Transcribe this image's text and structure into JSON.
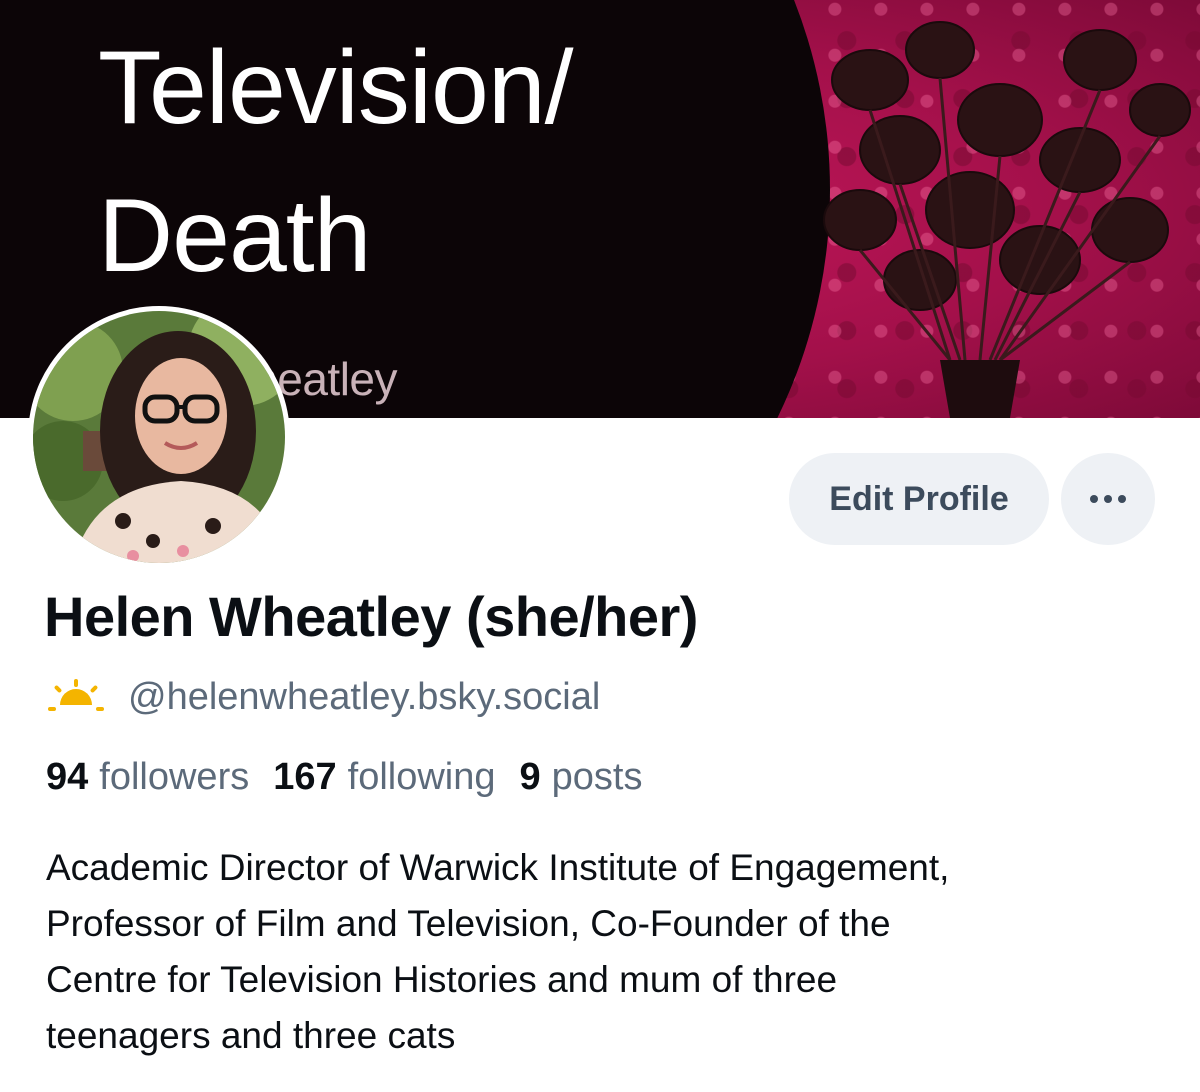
{
  "banner": {
    "title_line1": "Television/",
    "title_line2": "Death",
    "author_fragment": "Vheatley"
  },
  "profile": {
    "display_name": "Helen Wheatley (she/her)",
    "handle": "@helenwheatley.bsky.social",
    "handle_icon": "sun-icon",
    "avatar_icon": "avatar-photo"
  },
  "actions": {
    "edit_profile_label": "Edit Profile",
    "more_icon": "ellipsis-icon"
  },
  "stats": {
    "followers_count": "94",
    "followers_label": "followers",
    "following_count": "167",
    "following_label": "following",
    "posts_count": "9",
    "posts_label": "posts"
  },
  "bio": {
    "line1": "Academic Director of Warwick Institute of Engagement,",
    "line2": "Professor of Film and Television, Co-Founder of the",
    "line3": "Centre for Television Histories and mum of three",
    "line4": "teenagers and three cats"
  },
  "colors": {
    "banner_pink": "#a3104a",
    "banner_black": "#0c0507",
    "button_bg": "#eef1f5",
    "muted_text": "#5c6a7a",
    "primary_text": "#0b0f14",
    "sun_yellow": "#f4b400"
  }
}
